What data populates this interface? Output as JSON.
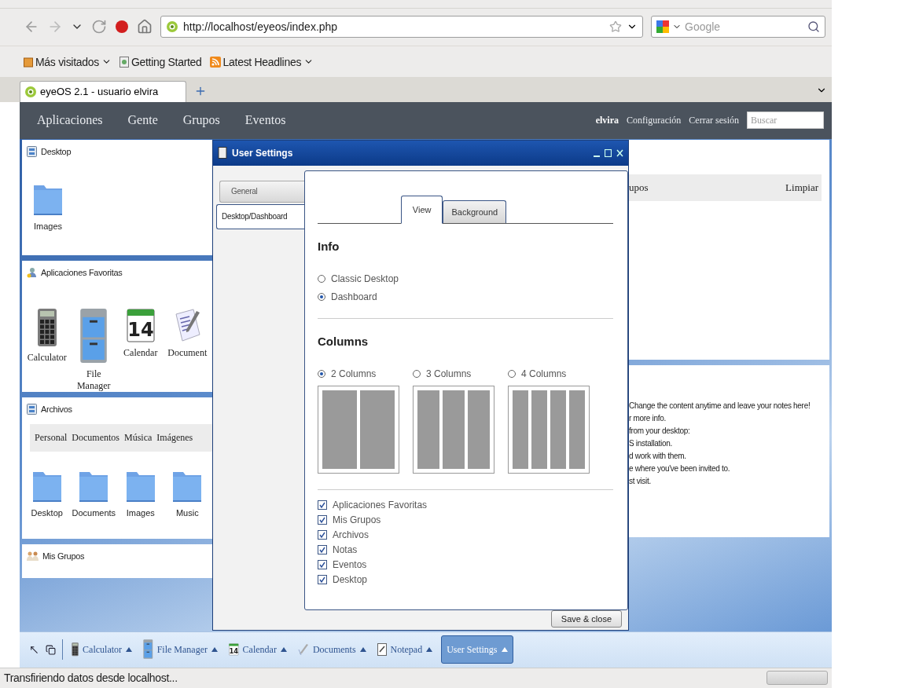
{
  "browser": {
    "url": "http://localhost/eyeos/index.php",
    "search": {
      "placeholder": "Google"
    },
    "bookmarks": [
      {
        "label": "Más visitados",
        "kind": "folder"
      },
      {
        "label": "Getting Started",
        "kind": "page"
      },
      {
        "label": "Latest Headlines",
        "kind": "feed"
      }
    ],
    "tabs": [
      {
        "title": "eyeOS 2.1 - usuario elvira",
        "selected": true
      }
    ]
  },
  "topbar": {
    "menu": [
      "Aplicaciones",
      "Gente",
      "Grupos",
      "Eventos"
    ],
    "user": "elvira",
    "links": [
      "Configuración",
      "Cerrar sesión"
    ],
    "search": {
      "placeholder": "Buscar"
    }
  },
  "left_widgets": [
    {
      "title": "Desktop",
      "kind": "drawer",
      "items": [
        {
          "label": "Images",
          "kind": "folder"
        }
      ]
    },
    {
      "title": "Aplicaciones Favoritas",
      "kind": "person",
      "items": [
        {
          "label": "Calculator",
          "kind": "calculator"
        },
        {
          "label": "File Manager",
          "kind": "cabinet"
        },
        {
          "label": "Calendar",
          "kind": "calendar",
          "badge": "14"
        },
        {
          "label": "Document",
          "kind": "document"
        }
      ]
    },
    {
      "title": "Archivos",
      "kind": "drawer",
      "toolbar": [
        "Personal",
        "Documentos",
        "Música",
        "Imágenes"
      ],
      "items": [
        {
          "label": "Desktop",
          "kind": "folder"
        },
        {
          "label": "Documents",
          "kind": "folder"
        },
        {
          "label": "Images",
          "kind": "folder"
        },
        {
          "label": "Music",
          "kind": "folder"
        }
      ]
    },
    {
      "title": "Mis Grupos",
      "kind": "people"
    }
  ],
  "right_widgets": [
    {
      "toolbar_left": "upos",
      "toolbar_right": "Limpiar"
    },
    {
      "lines": [
        "Change the content anytime and leave your notes here!",
        "r more info.",
        "from your desktop:",
        "S installation.",
        "d work with them.",
        "e where you've been invited to.",
        "st visit."
      ]
    }
  ],
  "dialog": {
    "title": "User Settings",
    "nav": [
      {
        "label": "General",
        "selected": false
      },
      {
        "label": "Desktop/Dashboard",
        "selected": true
      }
    ],
    "tabs": [
      {
        "label": "View",
        "selected": true
      },
      {
        "label": "Background",
        "selected": false
      }
    ],
    "info": {
      "heading": "Info",
      "options": [
        {
          "label": "Classic Desktop",
          "selected": false
        },
        {
          "label": "Dashboard",
          "selected": true
        }
      ]
    },
    "columns": {
      "heading": "Columns",
      "options": [
        {
          "label": "2 Columns",
          "selected": true
        },
        {
          "label": "3 Columns",
          "selected": false
        },
        {
          "label": "4 Columns",
          "selected": false
        }
      ]
    },
    "widgets": [
      {
        "label": "Aplicaciones Favoritas",
        "checked": true
      },
      {
        "label": "Mis Grupos",
        "checked": true
      },
      {
        "label": "Archivos",
        "checked": true
      },
      {
        "label": "Notas",
        "checked": true
      },
      {
        "label": "Eventos",
        "checked": true
      },
      {
        "label": "Desktop",
        "checked": true
      }
    ],
    "button": "Save & close"
  },
  "taskbar": {
    "items": [
      {
        "label": "Calculator",
        "kind": "calculator",
        "selected": false
      },
      {
        "label": "File Manager",
        "kind": "cabinet",
        "selected": false
      },
      {
        "label": "Calendar",
        "kind": "calendar",
        "badge": "14",
        "selected": false
      },
      {
        "label": "Documents",
        "kind": "pen",
        "selected": false
      },
      {
        "label": "Notepad",
        "kind": "notepad",
        "selected": false
      },
      {
        "label": "User Settings",
        "kind": "plain",
        "selected": true
      }
    ]
  },
  "status": "Transfiriendo datos desde localhost..."
}
